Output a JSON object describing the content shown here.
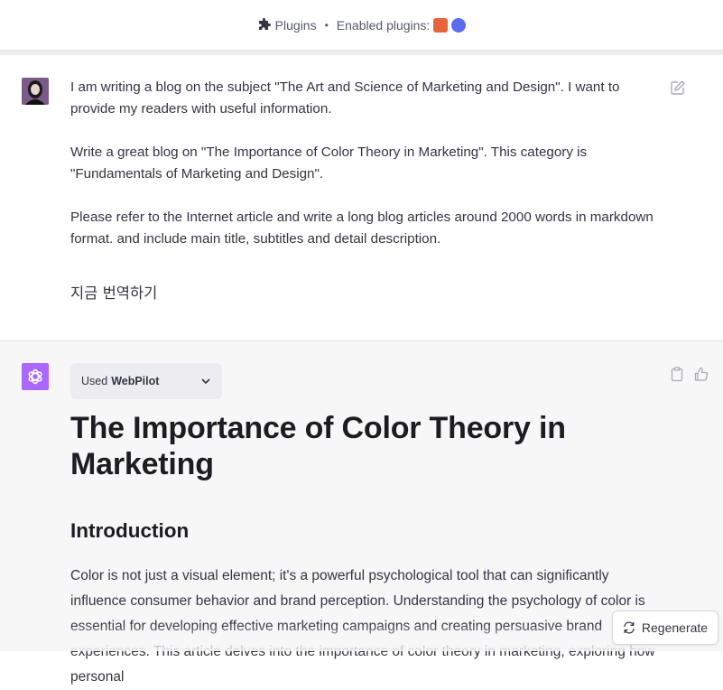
{
  "topbar": {
    "plugins_label": "Plugins",
    "separator": "•",
    "enabled_label": "Enabled plugins:"
  },
  "user_message": {
    "paragraphs": [
      "I am writing a blog on the subject \"The Art and Science of Marketing and Design\". I want to provide my readers with useful information.",
      "Write a great blog on \"The Importance of Color Theory in Marketing\". This category is \"Fundamentals of Marketing and Design\".",
      "Please refer to the Internet article and write a long blog articles around 2000 words in markdown format. and include main title, subtitles and detail description."
    ],
    "translate_label": "지금 번역하기"
  },
  "assistant": {
    "used_prefix": "Used",
    "used_tool": "WebPilot",
    "title": "The Importance of Color Theory in Marketing",
    "section_heading": "Introduction",
    "intro": "Color is not just a visual element; it's a powerful psychological tool that can significantly influence consumer behavior and brand perception. Understanding the psychology of color is essential for developing effective marketing campaigns and creating persuasive brand experiences. This article delves into the importance of color theory in marketing, exploring how personal"
  },
  "regenerate_label": "Regenerate",
  "colors": {
    "gpt_avatar": "#ab68ff",
    "plugin_orange": "#e8643c",
    "plugin_blue": "#5b6cf0"
  },
  "icons": [
    "puzzle-icon",
    "edit-icon",
    "clipboard-icon",
    "thumbs-up-icon",
    "chevron-down-icon",
    "refresh-icon",
    "openai-logo-icon"
  ]
}
